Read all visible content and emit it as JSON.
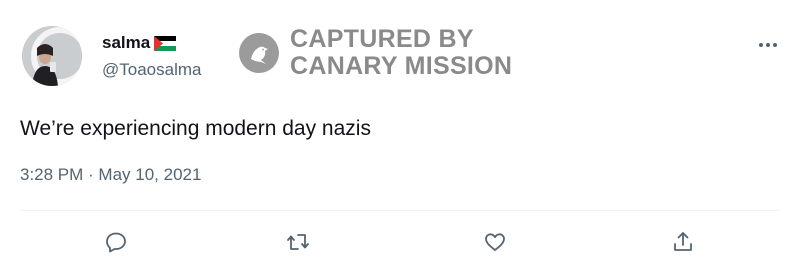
{
  "author": {
    "display_name": "salma",
    "flag_icon": "palestine-flag-icon",
    "handle": "@Toaosalma",
    "avatar_icon": "profile-avatar"
  },
  "watermark": {
    "icon": "canary-bird-icon",
    "line1": "CAPTURED BY",
    "line2": "CANARY MISSION",
    "color": "#8a8a8a"
  },
  "menu": {
    "icon": "more-options-icon"
  },
  "tweet": {
    "text": "We’re experiencing modern day nazis",
    "meta": "3:28 PM · May 10, 2021"
  },
  "actions": [
    {
      "name": "reply",
      "icon": "reply-icon"
    },
    {
      "name": "retweet",
      "icon": "retweet-icon"
    },
    {
      "name": "like",
      "icon": "heart-icon"
    },
    {
      "name": "share",
      "icon": "share-icon"
    }
  ],
  "colors": {
    "text_primary": "#0f1419",
    "text_secondary": "#536471",
    "icon": "#536471",
    "divider": "#eff3f4"
  }
}
